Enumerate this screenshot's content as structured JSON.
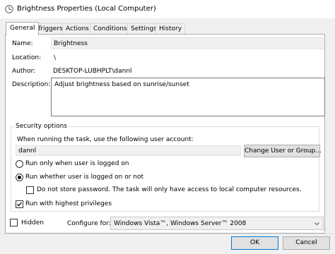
{
  "window": {
    "title": "Brightness Properties (Local Computer)"
  },
  "tabs": [
    {
      "label": "General"
    },
    {
      "label": "Triggers"
    },
    {
      "label": "Actions"
    },
    {
      "label": "Conditions"
    },
    {
      "label": "Settings"
    },
    {
      "label": "History"
    }
  ],
  "general": {
    "name_label": "Name:",
    "name_value": "Brightness",
    "location_label": "Location:",
    "location_value": "\\",
    "author_label": "Author:",
    "author_value": "DESKTOP-LUBHPLT\\dannl",
    "description_label": "Description:",
    "description_value": "Adjust brightness based on sunrise/sunset"
  },
  "security": {
    "group_title": "Security options",
    "account_prompt": "When running the task, use the following user account:",
    "account_value": "dannl",
    "change_button": "Change User or Group...",
    "radio_logged_on": "Run only when user is logged on",
    "radio_whether": "Run whether user is logged on or not",
    "selected_option": "Run whether user is logged on or not",
    "no_store_password": "Do not store password.  The task will only have access to local computer resources.",
    "no_store_password_checked": false,
    "highest_privileges": "Run with highest privileges",
    "highest_privileges_checked": true
  },
  "bottom": {
    "hidden_label": "Hidden",
    "hidden_checked": false,
    "configure_label": "Configure for:",
    "configure_value": "Windows Vista™, Windows Server™ 2008"
  },
  "buttons": {
    "ok": "OK",
    "cancel": "Cancel"
  },
  "colors": {
    "accent": "#0078d7",
    "panel": "#ffffff",
    "chrome": "#f0f0f0"
  }
}
